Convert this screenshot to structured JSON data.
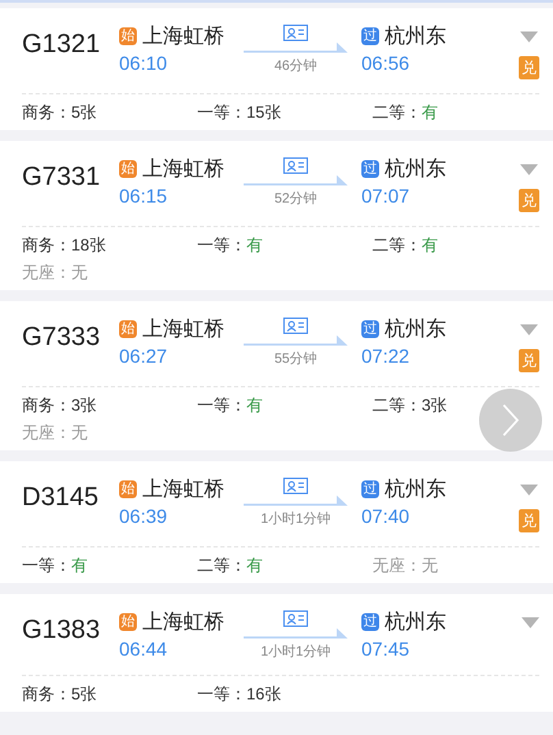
{
  "trains": [
    {
      "number": "G1321",
      "from": {
        "badge": "始",
        "station": "上海虹桥",
        "time": "06:10"
      },
      "duration": "46分钟",
      "to": {
        "badge": "过",
        "station": "杭州东",
        "time": "06:56"
      },
      "exchange": "兑",
      "seats": [
        {
          "label": "商务：",
          "value": "5张",
          "kind": "count"
        },
        {
          "label": "一等：",
          "value": "15张",
          "kind": "count"
        },
        {
          "label": "二等：",
          "value": "有",
          "kind": "available"
        }
      ]
    },
    {
      "number": "G7331",
      "from": {
        "badge": "始",
        "station": "上海虹桥",
        "time": "06:15"
      },
      "duration": "52分钟",
      "to": {
        "badge": "过",
        "station": "杭州东",
        "time": "07:07"
      },
      "exchange": "兑",
      "seats": [
        {
          "label": "商务：",
          "value": "18张",
          "kind": "count"
        },
        {
          "label": "一等：",
          "value": "有",
          "kind": "available"
        },
        {
          "label": "二等：",
          "value": "有",
          "kind": "available"
        },
        {
          "label": "无座：",
          "value": "无",
          "kind": "none"
        }
      ]
    },
    {
      "number": "G7333",
      "from": {
        "badge": "始",
        "station": "上海虹桥",
        "time": "06:27"
      },
      "duration": "55分钟",
      "to": {
        "badge": "过",
        "station": "杭州东",
        "time": "07:22"
      },
      "exchange": "兑",
      "seats": [
        {
          "label": "商务：",
          "value": "3张",
          "kind": "count"
        },
        {
          "label": "一等：",
          "value": "有",
          "kind": "available"
        },
        {
          "label": "二等：",
          "value": "3张",
          "kind": "count"
        },
        {
          "label": "无座：",
          "value": "无",
          "kind": "none"
        }
      ]
    },
    {
      "number": "D3145",
      "from": {
        "badge": "始",
        "station": "上海虹桥",
        "time": "06:39"
      },
      "duration": "1小时1分钟",
      "to": {
        "badge": "过",
        "station": "杭州东",
        "time": "07:40"
      },
      "exchange": "兑",
      "seats": [
        {
          "label": "一等：",
          "value": "有",
          "kind": "available"
        },
        {
          "label": "二等：",
          "value": "有",
          "kind": "available"
        },
        {
          "label": "无座：",
          "value": "无",
          "kind": "none"
        }
      ]
    },
    {
      "number": "G1383",
      "from": {
        "badge": "始",
        "station": "上海虹桥",
        "time": "06:44"
      },
      "duration": "1小时1分钟",
      "to": {
        "badge": "过",
        "station": "杭州东",
        "time": "07:45"
      },
      "seats": [
        {
          "label": "商务：",
          "value": "5张",
          "kind": "count"
        },
        {
          "label": "一等：",
          "value": "16张",
          "kind": "count"
        }
      ]
    }
  ]
}
